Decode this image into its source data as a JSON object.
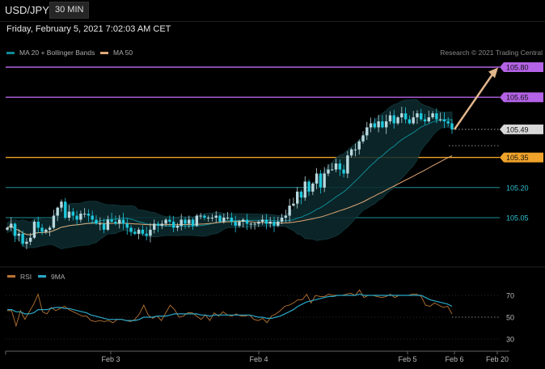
{
  "header": {
    "symbol": "USD/JPY",
    "timeframe": "30 MIN"
  },
  "timestamp": "Friday, February 5, 2021 7:02:03 AM CET",
  "credit": "Research © 2021 Trading Central",
  "colors": {
    "ma20_bands": "#0e8b96",
    "ma50": "#e0a775",
    "resistance": "#b462e6",
    "support": "#f0a32a",
    "pivot": "#1a8f98",
    "rsi": "#b97433",
    "rsi_ma": "#2aa8c8",
    "candle_up": "#b8d8de",
    "candle_down": "#1ec8dc",
    "arrow": "#e0b58c"
  },
  "chart_data": [
    {
      "type": "candlestick",
      "legend": [
        {
          "name": "MA 20 + Bollinger Bands",
          "color": "#0e8b96"
        },
        {
          "name": "MA 50",
          "color": "#e0a775"
        }
      ],
      "x_labels": [
        "Feb 3",
        "Feb 4",
        "Feb 5",
        "Feb 6",
        "Feb 20"
      ],
      "ylim": [
        104.85,
        105.9
      ],
      "last_price": 105.49,
      "levels": [
        {
          "label": "105.80",
          "value": 105.8,
          "kind": "resistance"
        },
        {
          "label": "105.65",
          "value": 105.65,
          "kind": "resistance"
        },
        {
          "label": "105.49",
          "value": 105.49,
          "kind": "current"
        },
        {
          "label": "105.35",
          "value": 105.35,
          "kind": "support"
        },
        {
          "label": "105.20",
          "value": 105.2,
          "kind": "pivot"
        },
        {
          "label": "105.05",
          "value": 105.05,
          "kind": "pivot"
        }
      ],
      "close": [
        105.0,
        105.02,
        104.96,
        104.97,
        104.92,
        104.93,
        104.95,
        105.03,
        105.0,
        104.98,
        104.99,
        105.0,
        105.06,
        105.1,
        105.13,
        105.05,
        105.08,
        105.06,
        105.04,
        105.07,
        105.07,
        105.06,
        105.04,
        105.02,
        105.02,
        104.99,
        105.04,
        105.03,
        105.02,
        105.04,
        105.02,
        105.0,
        104.98,
        104.97,
        104.99,
        104.97,
        104.96,
        104.99,
        105.02,
        105.01,
        105.02,
        105.04,
        105.03,
        105.0,
        105.01,
        105.04,
        105.02,
        105.04,
        105.01,
        105.06,
        105.06,
        105.05,
        105.05,
        105.05,
        105.06,
        105.03,
        105.05,
        105.05,
        105.03,
        105.01,
        105.03,
        105.04,
        105.02,
        105.02,
        105.02,
        105.03,
        105.04,
        105.02,
        105.03,
        105.01,
        105.03,
        105.05,
        105.06,
        105.11,
        105.12,
        105.18,
        105.15,
        105.23,
        105.18,
        105.22,
        105.27,
        105.2,
        105.27,
        105.29,
        105.29,
        105.32,
        105.29,
        105.27,
        105.36,
        105.39,
        105.39,
        105.43,
        105.46,
        105.5,
        105.52,
        105.5,
        105.53,
        105.5,
        105.53,
        105.56,
        105.52,
        105.55,
        105.57,
        105.54,
        105.52,
        105.55,
        105.57,
        105.54,
        105.53,
        105.55,
        105.57,
        105.54,
        105.54,
        105.53,
        105.52,
        105.49
      ]
    },
    {
      "type": "line",
      "legend": [
        {
          "name": "RSI",
          "color": "#b97433"
        },
        {
          "name": "9MA",
          "color": "#2aa8c8"
        }
      ],
      "y_ticks": [
        70,
        50,
        30
      ],
      "ylim": [
        20,
        80
      ],
      "series": [
        {
          "name": "RSI",
          "values": [
            56,
            56,
            42,
            56,
            48,
            55,
            62,
            71,
            55,
            53,
            59,
            56,
            58,
            60,
            57,
            55,
            53,
            51,
            51,
            47,
            46,
            47,
            46,
            47,
            45,
            48,
            48,
            47,
            46,
            48,
            53,
            61,
            52,
            49,
            51,
            47,
            54,
            61,
            57,
            50,
            51,
            54,
            54,
            51,
            48,
            52,
            47,
            54,
            51,
            55,
            52,
            51,
            53,
            51,
            51,
            52,
            48,
            47,
            49,
            45,
            51,
            53,
            56,
            60,
            61,
            63,
            66,
            66,
            71,
            63,
            70,
            69,
            69,
            71,
            70,
            70,
            70,
            71,
            72,
            70,
            75,
            68,
            70,
            70,
            69,
            68,
            69,
            71,
            68,
            70,
            70,
            70,
            71,
            71,
            69,
            61,
            60,
            63,
            61,
            59,
            60,
            53
          ]
        },
        {
          "name": "9MA",
          "values": [
            57,
            57,
            55,
            55,
            53,
            53,
            54,
            57,
            57,
            57,
            58,
            59,
            59,
            58,
            58,
            57,
            56,
            55,
            54,
            52,
            51,
            50,
            49,
            48,
            48,
            48,
            48,
            47,
            47,
            47,
            48,
            50,
            50,
            50,
            51,
            51,
            51,
            52,
            53,
            53,
            53,
            53,
            53,
            53,
            52,
            52,
            51,
            52,
            52,
            52,
            52,
            52,
            52,
            52,
            52,
            52,
            51,
            50,
            50,
            49,
            49,
            50,
            51,
            53,
            55,
            57,
            60,
            62,
            64,
            65,
            66,
            67,
            68,
            69,
            69,
            70,
            70,
            70,
            70,
            70,
            71,
            70,
            70,
            70,
            70,
            70,
            70,
            70,
            70,
            70,
            70,
            70,
            70,
            70,
            70,
            68,
            66,
            65,
            64,
            63,
            62,
            60
          ]
        }
      ]
    }
  ]
}
